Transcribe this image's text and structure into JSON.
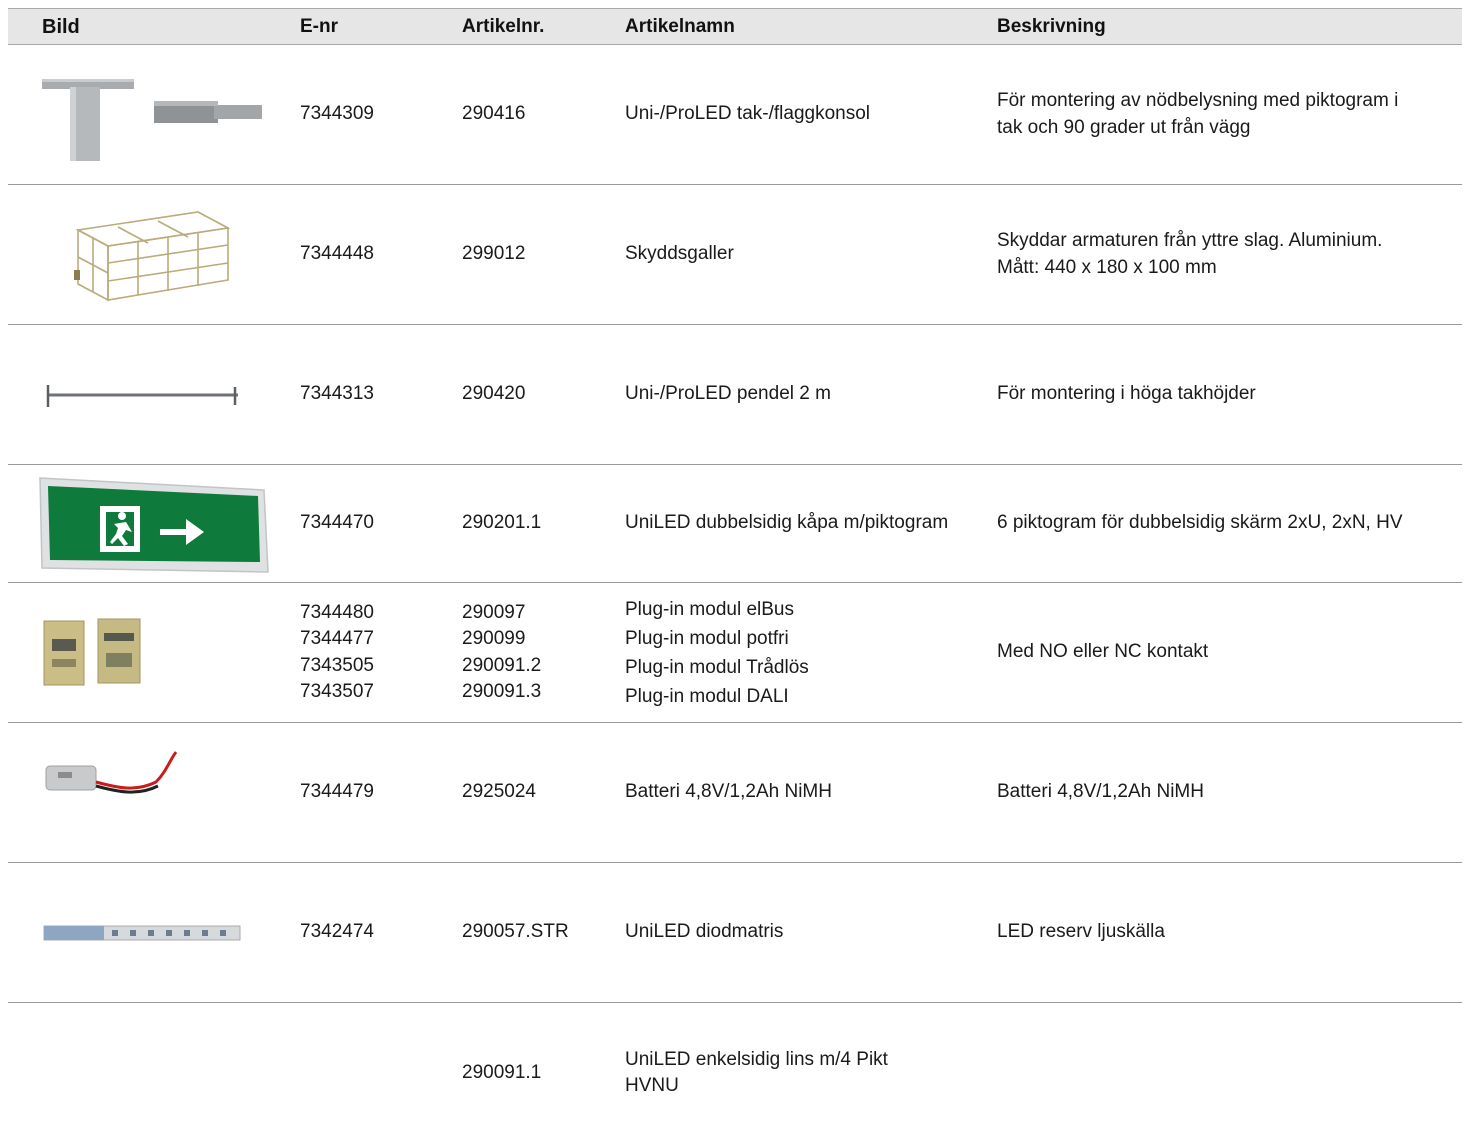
{
  "header": {
    "bild": "Bild",
    "enr": "E-nr",
    "artikelnr": "Artikelnr.",
    "artikelnamn": "Artikelnamn",
    "beskrivning": "Beskrivning"
  },
  "rows": [
    {
      "image": "bracket-image",
      "enr": [
        "7344309"
      ],
      "artikelnr": [
        "290416"
      ],
      "artikelnamn": [
        "Uni-/ProLED tak-/flaggkonsol"
      ],
      "beskrivning": [
        "För montering av nödbelysning med piktogram i",
        "tak och 90 grader ut från vägg"
      ]
    },
    {
      "image": "cage-image",
      "enr": [
        "7344448"
      ],
      "artikelnr": [
        "299012"
      ],
      "artikelnamn": [
        "Skyddsgaller"
      ],
      "beskrivning": [
        "Skyddar armaturen från yttre slag. Aluminium.",
        "Mått: 440 x 180 x 100 mm"
      ]
    },
    {
      "image": "pendant-rod-image",
      "enr": [
        "7344313"
      ],
      "artikelnr": [
        "290420"
      ],
      "artikelnamn": [
        "Uni-/ProLED pendel 2 m"
      ],
      "beskrivning": [
        "För montering i höga takhöjder"
      ]
    },
    {
      "image": "exit-sign-image",
      "enr": [
        "7344470"
      ],
      "artikelnr": [
        "290201.1"
      ],
      "artikelnamn": [
        "UniLED dubbelsidig kåpa m/piktogram"
      ],
      "beskrivning": [
        "6 piktogram för dubbelsidig skärm 2xU, 2xN, HV"
      ]
    },
    {
      "image": "plugin-module-image",
      "enr": [
        "7344480",
        "7344477",
        "7343505",
        "7343507"
      ],
      "artikelnr": [
        "290097",
        "290099",
        "290091.2",
        "290091.3"
      ],
      "artikelnamn": [
        "Plug-in modul elBus",
        "Plug-in modul potfri",
        "Plug-in modul Trådlös",
        "Plug-in modul DALI"
      ],
      "beskrivning": [
        "Med NO eller NC kontakt"
      ]
    },
    {
      "image": "battery-image",
      "enr": [
        "7344479"
      ],
      "artikelnr": [
        "2925024"
      ],
      "artikelnamn": [
        "Batteri 4,8V/1,2Ah NiMH"
      ],
      "beskrivning": [
        "Batteri 4,8V/1,2Ah NiMH"
      ]
    },
    {
      "image": "led-strip-image",
      "enr": [
        "7342474"
      ],
      "artikelnr": [
        "290057.STR"
      ],
      "artikelnamn": [
        "UniLED diodmatris"
      ],
      "beskrivning": [
        "LED reserv ljuskälla"
      ]
    },
    {
      "image": "",
      "enr": [],
      "artikelnr": [
        "290091.1"
      ],
      "artikelnamn": [
        "UniLED enkelsidig lins m/4 Pikt",
        "HVNU"
      ],
      "beskrivning": []
    }
  ],
  "colors": {
    "header_bg": "#e6e6e6",
    "rule": "#9a9a9a",
    "exit_green": "#0e7a3c"
  }
}
